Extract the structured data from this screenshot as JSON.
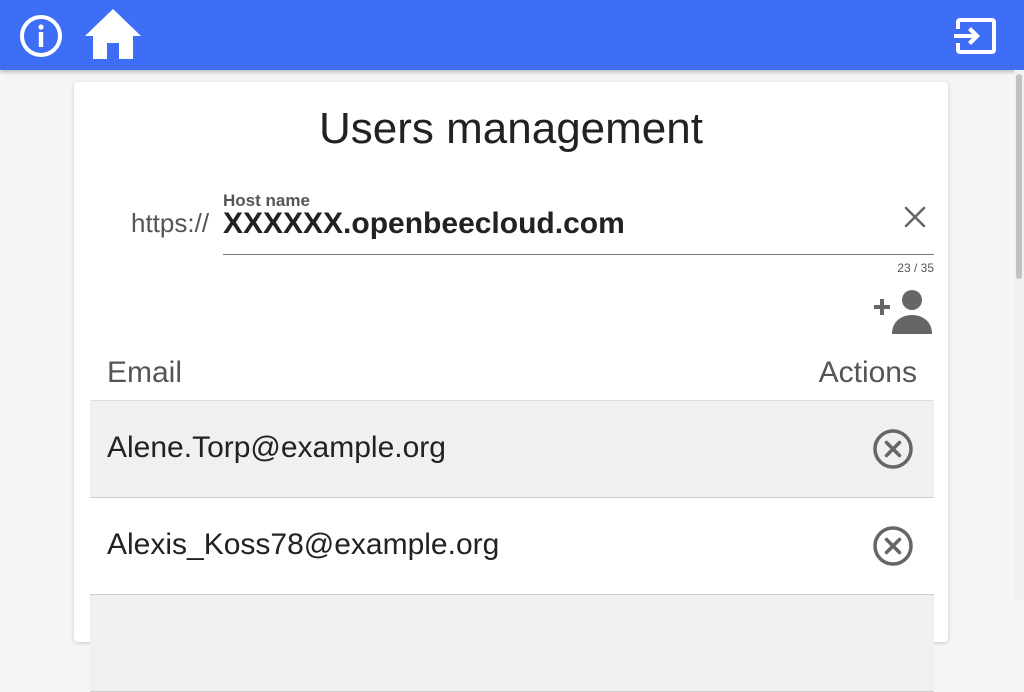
{
  "header": {
    "info_icon": "info-circle-icon",
    "home_icon": "home-icon",
    "logout_icon": "logout-icon",
    "bar_color": "#3d6ef5"
  },
  "page": {
    "title": "Users management"
  },
  "host": {
    "prefix": "https://",
    "label": "Host name",
    "value": "XXXXXX.openbeecloud.com",
    "counter": "23 / 35",
    "clear_icon": "close-icon"
  },
  "add_user_icon": "person-add-icon",
  "table": {
    "headers": {
      "email": "Email",
      "actions": "Actions"
    },
    "rows": [
      {
        "email": "Alene.Torp@example.org",
        "action_icon": "cancel-circle-icon"
      },
      {
        "email": "Alexis_Koss78@example.org",
        "action_icon": "cancel-circle-icon"
      }
    ]
  }
}
